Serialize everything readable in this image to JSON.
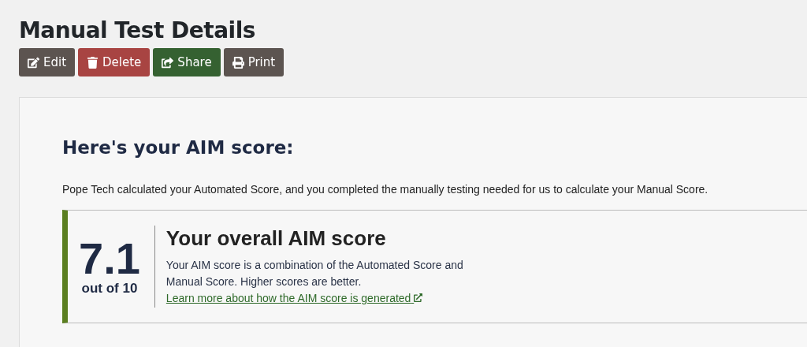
{
  "page_title": "Manual Test Details",
  "buttons": [
    {
      "label": "Edit",
      "kind": "edit"
    },
    {
      "label": "Delete",
      "kind": "delete"
    },
    {
      "label": "Share",
      "kind": "share"
    },
    {
      "label": "Print",
      "kind": "print"
    }
  ],
  "card": {
    "heading": "Here's your AIM score:",
    "intro": "Pope Tech calculated your Automated Score, and you completed the manually testing needed for us to calculate your Manual Score.",
    "score": {
      "value": "7.1",
      "out_of": "out of 10",
      "title": "Your overall AIM score",
      "description": "Your AIM score is a combination of the Automated Score and Manual Score. Higher scores are better.",
      "link": "Learn more about how the AIM score is generated"
    }
  }
}
